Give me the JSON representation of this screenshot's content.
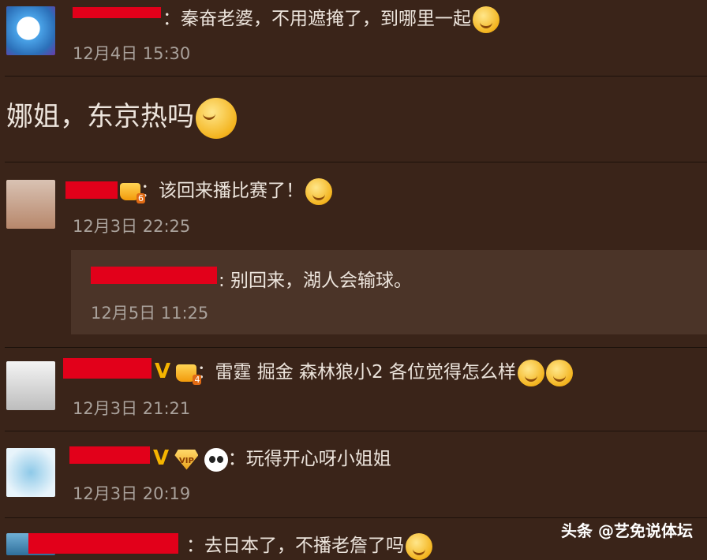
{
  "comments": [
    {
      "text": "：秦奋老婆，不用遮掩了，到哪里一起",
      "time": "12月4日 15:30"
    },
    {
      "big_text": "娜姐，东京热吗"
    },
    {
      "text": "：该回来播比赛了！",
      "time": "12月3日 22:25",
      "crown_level": "6",
      "reply": {
        "text": ": 别回来，湖人会输球。",
        "time": "12月5日 11:25"
      }
    },
    {
      "text": "：雷霆 掘金 森林狼小2 各位觉得怎么样",
      "time": "12月3日 21:21",
      "verified": "V",
      "crown_level": "4"
    },
    {
      "text": "：玩得开心呀小姐姐",
      "time": "12月3日 20:19",
      "verified": "V",
      "vip": "VIP"
    },
    {
      "text": "：去日本了，不播老詹了吗"
    }
  ],
  "watermark": "头条 @艺免说体坛",
  "colors": {
    "background": "#3a2419",
    "reply_bg": "#4b3428",
    "redaction": "#e2001a",
    "time": "#a9a19b"
  }
}
